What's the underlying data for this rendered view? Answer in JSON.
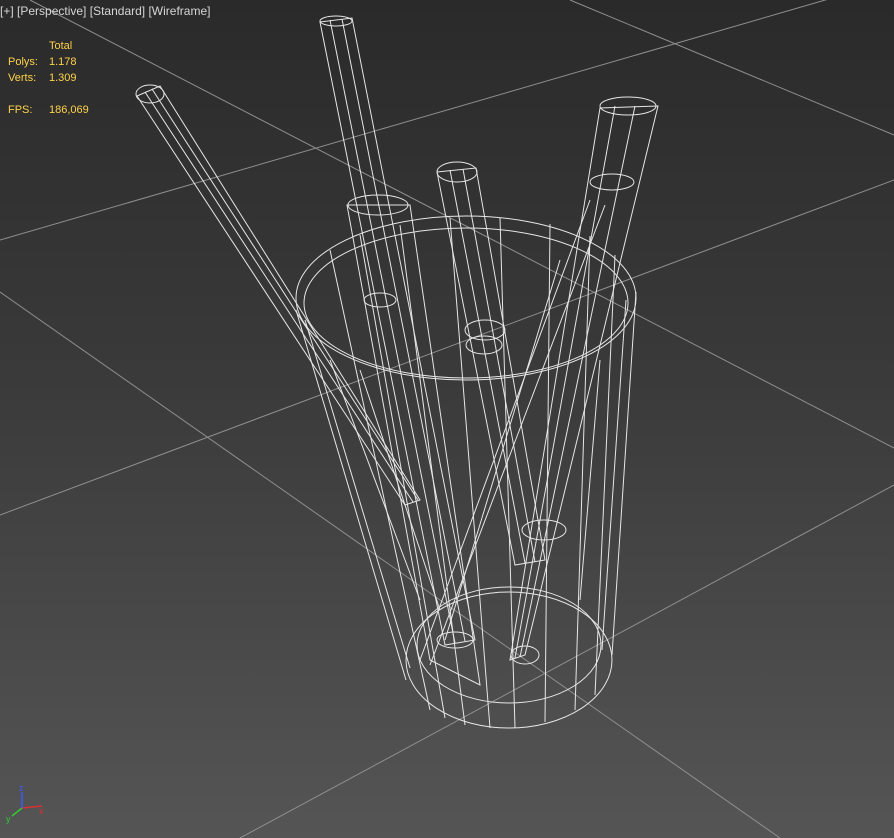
{
  "viewport": {
    "labels": [
      "[+]",
      "[Perspective]",
      "[Standard]",
      "[Wireframe]"
    ]
  },
  "stats": {
    "header": "Total",
    "polys_label": "Polys:",
    "polys_value": "1.178",
    "verts_label": "Verts:",
    "verts_value": "1.309",
    "fps_label": "FPS:",
    "fps_value": "186,069"
  },
  "gizmo": {
    "axes": [
      "x",
      "y",
      "z"
    ],
    "colors": {
      "x": "#d83232",
      "y": "#32c832",
      "z": "#3a5cff"
    }
  },
  "colors": {
    "wire": "#f2f2f2",
    "grid": "#9a9a9a",
    "hud_text": "#d6d6d6",
    "stats_text": "#ffd24a"
  }
}
